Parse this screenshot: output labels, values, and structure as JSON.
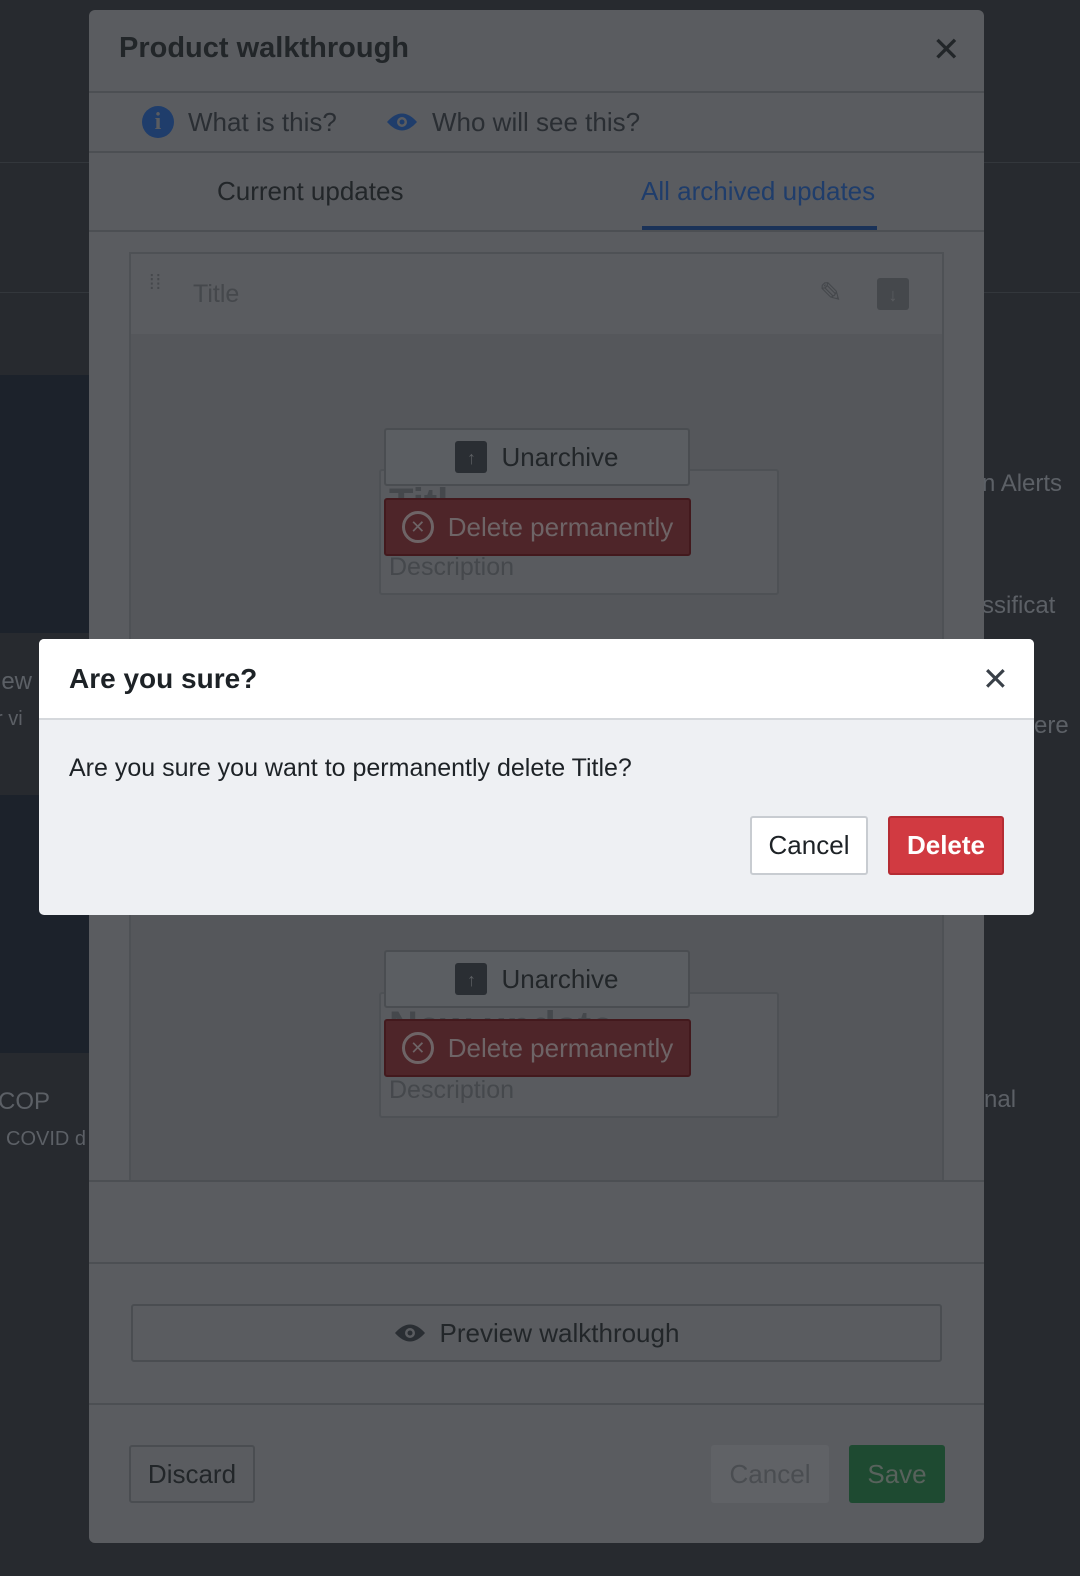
{
  "background": {
    "left_texts": [
      "iew",
      "r vi",
      "COP",
      "COVID d"
    ],
    "right_texts": [
      "n Alerts",
      "ssificat",
      "ere",
      "nal"
    ]
  },
  "walkthrough_modal": {
    "title": "Product walkthrough",
    "info_links": [
      {
        "label": "What is this?",
        "icon": "info-icon"
      },
      {
        "label": "Who will see this?",
        "icon": "eye-icon"
      }
    ],
    "tabs": [
      {
        "label": "Current updates",
        "active": false
      },
      {
        "label": "All archived updates",
        "active": true
      }
    ],
    "cards": [
      {
        "header_title": "Title",
        "preview_title": "Title",
        "preview_description": "Description",
        "unarchive_label": "Unarchive",
        "delete_label": "Delete permanently"
      },
      {
        "preview_title": "New update",
        "preview_description": "Description",
        "unarchive_label": "Unarchive",
        "delete_label": "Delete permanently"
      }
    ],
    "preview_label": "Preview walkthrough",
    "footer": {
      "discard": "Discard",
      "cancel": "Cancel",
      "save": "Save"
    }
  },
  "confirm_dialog": {
    "title": "Are you sure?",
    "message": "Are you sure you want to permanently delete Title?",
    "cancel": "Cancel",
    "delete": "Delete"
  },
  "colors": {
    "accent": "#1f3d6b",
    "danger": "#d13a41",
    "success": "#1e4a31"
  }
}
